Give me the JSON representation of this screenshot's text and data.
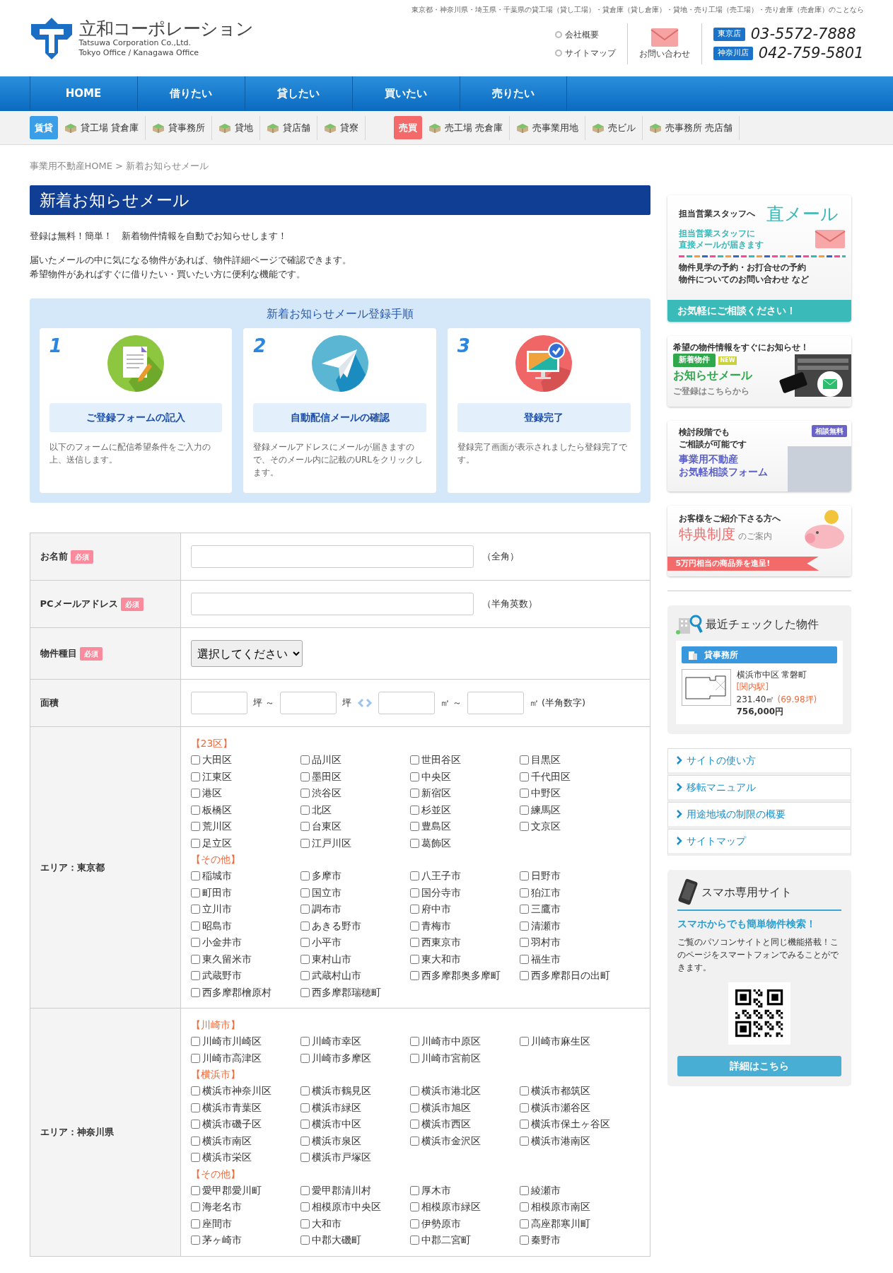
{
  "header": {
    "tagline": "東京都・神奈川県・埼玉県・千葉県の貸工場（貸し工場）・貸倉庫（貸し倉庫）・貸地・売り工場（売工場）・売り倉庫（売倉庫）のことなら",
    "company": "立和コーポレーション",
    "company_en": "Tatsuwa Corporation Co.,Ltd.",
    "offices_en": "Tokyo Office / Kanagawa Office",
    "links": [
      "会社概要",
      "サイトマップ"
    ],
    "contact": "お問い合わせ",
    "phones": [
      {
        "office": "東京店",
        "number": "03-5572-7888"
      },
      {
        "office": "神奈川店",
        "number": "042-759-5801"
      }
    ]
  },
  "main_nav": [
    "HOME",
    "借りたい",
    "貸したい",
    "買いたい",
    "売りたい"
  ],
  "sub_nav": [
    {
      "kind": "tag",
      "label": "賃貸",
      "color": "#3b9ee8"
    },
    {
      "kind": "link",
      "label": "貸工場 貸倉庫"
    },
    {
      "kind": "link",
      "label": "貸事務所"
    },
    {
      "kind": "link",
      "label": "貸地"
    },
    {
      "kind": "link",
      "label": "貸店舗"
    },
    {
      "kind": "link",
      "label": "貸寮"
    },
    {
      "kind": "tag",
      "label": "売買",
      "color": "#f26a6a"
    },
    {
      "kind": "link",
      "label": "売工場 売倉庫"
    },
    {
      "kind": "link",
      "label": "売事業用地"
    },
    {
      "kind": "link",
      "label": "売ビル"
    },
    {
      "kind": "link",
      "label": "売事務所 売店舗"
    }
  ],
  "breadcrumb": {
    "home": "事業用不動産HOME",
    "separator": ">",
    "current": "新着お知らせメール"
  },
  "page_title": "新着お知らせメール",
  "intro": [
    "登録は無料！簡単！　新着物件情報を自動でお知らせします！",
    "届いたメールの中に気になる物件があれば、物件詳細ページで確認できます。",
    "希望物件があればすぐに借りたい・買いたい方に便利な機能です。"
  ],
  "steps": {
    "title": "新着お知らせメール登録手順",
    "items": [
      {
        "number": "1",
        "heading": "ご登録フォームの記入",
        "text": "以下のフォームに配信希望条件をご入力の上、送信します。"
      },
      {
        "number": "2",
        "heading": "自動配信メールの確認",
        "text": "登録メールアドレスにメールが届きますので、そのメール内に記載のURLをクリックします。"
      },
      {
        "number": "3",
        "heading": "登録完了",
        "text": "登録完了画面が表示されましたら登録完了です。"
      }
    ]
  },
  "form": [
    {
      "kind": "text",
      "label": "お名前",
      "badge": "必須",
      "note": "（全角）"
    },
    {
      "kind": "text",
      "label": "PCメールアドレス",
      "badge": "必須",
      "note": "（半角英数）"
    },
    {
      "kind": "select",
      "label": "物件種目",
      "badge": "必須",
      "value": "選択してください"
    },
    {
      "kind": "range",
      "label": "面積",
      "units": [
        "坪 ～",
        "坪",
        "㎡ ～",
        "㎡ (半角数字)"
      ]
    },
    {
      "kind": "areas",
      "label": "エリア：東京都",
      "groups": [
        {
          "title": "【23区】",
          "options": [
            {
              "label": "大田区",
              "checked": false
            },
            {
              "label": "品川区",
              "checked": false
            },
            {
              "label": "世田谷区",
              "checked": false
            },
            {
              "label": "目黒区",
              "checked": false
            },
            {
              "label": "江東区",
              "checked": false
            },
            {
              "label": "墨田区",
              "checked": false
            },
            {
              "label": "中央区",
              "checked": false
            },
            {
              "label": "千代田区",
              "checked": false
            },
            {
              "label": "港区",
              "checked": false
            },
            {
              "label": "渋谷区",
              "checked": false
            },
            {
              "label": "新宿区",
              "checked": false
            },
            {
              "label": "中野区",
              "checked": false
            },
            {
              "label": "板橋区",
              "checked": false
            },
            {
              "label": "北区",
              "checked": false
            },
            {
              "label": "杉並区",
              "checked": false
            },
            {
              "label": "練馬区",
              "checked": false
            },
            {
              "label": "荒川区",
              "checked": false
            },
            {
              "label": "台東区",
              "checked": false
            },
            {
              "label": "豊島区",
              "checked": false
            },
            {
              "label": "文京区",
              "checked": false
            },
            {
              "label": "足立区",
              "checked": false
            },
            {
              "label": "江戸川区",
              "checked": false
            },
            {
              "label": "葛飾区",
              "checked": false
            }
          ]
        },
        {
          "title": "【その他】",
          "options": [
            {
              "label": "稲城市",
              "checked": false
            },
            {
              "label": "多摩市",
              "checked": false
            },
            {
              "label": "八王子市",
              "checked": false
            },
            {
              "label": "日野市",
              "checked": false
            },
            {
              "label": "町田市",
              "checked": false
            },
            {
              "label": "国立市",
              "checked": false
            },
            {
              "label": "国分寺市",
              "checked": false
            },
            {
              "label": "狛江市",
              "checked": false
            },
            {
              "label": "立川市",
              "checked": false
            },
            {
              "label": "調布市",
              "checked": false
            },
            {
              "label": "府中市",
              "checked": false
            },
            {
              "label": "三鷹市",
              "checked": false
            },
            {
              "label": "昭島市",
              "checked": false
            },
            {
              "label": "あきる野市",
              "checked": false
            },
            {
              "label": "青梅市",
              "checked": false
            },
            {
              "label": "清瀬市",
              "checked": false
            },
            {
              "label": "小金井市",
              "checked": false
            },
            {
              "label": "小平市",
              "checked": false
            },
            {
              "label": "西東京市",
              "checked": false
            },
            {
              "label": "羽村市",
              "checked": false
            },
            {
              "label": "東久留米市",
              "checked": false
            },
            {
              "label": "東村山市",
              "checked": false
            },
            {
              "label": "東大和市",
              "checked": false
            },
            {
              "label": "福生市",
              "checked": false
            },
            {
              "label": "武蔵野市",
              "checked": false
            },
            {
              "label": "武蔵村山市",
              "checked": false
            },
            {
              "label": "西多摩郡奥多摩町",
              "checked": false
            },
            {
              "label": "西多摩郡日の出町",
              "checked": false
            },
            {
              "label": "西多摩郡檜原村",
              "checked": false
            },
            {
              "label": "西多摩郡瑞穂町",
              "checked": false
            }
          ]
        }
      ]
    },
    {
      "kind": "areas",
      "label": "エリア：神奈川県",
      "groups": [
        {
          "title": "【川崎市】",
          "options": [
            {
              "label": "川崎市川崎区",
              "checked": false
            },
            {
              "label": "川崎市幸区",
              "checked": false
            },
            {
              "label": "川崎市中原区",
              "checked": false
            },
            {
              "label": "川崎市麻生区",
              "checked": false
            },
            {
              "label": "川崎市高津区",
              "checked": false
            },
            {
              "label": "川崎市多摩区",
              "checked": false
            },
            {
              "label": "川崎市宮前区",
              "checked": false
            }
          ]
        },
        {
          "title": "【横浜市】",
          "options": [
            {
              "label": "横浜市神奈川区",
              "checked": false
            },
            {
              "label": "横浜市鶴見区",
              "checked": false
            },
            {
              "label": "横浜市港北区",
              "checked": false
            },
            {
              "label": "横浜市都筑区",
              "checked": false
            },
            {
              "label": "横浜市青葉区",
              "checked": false
            },
            {
              "label": "横浜市緑区",
              "checked": false
            },
            {
              "label": "横浜市旭区",
              "checked": false
            },
            {
              "label": "横浜市瀬谷区",
              "checked": false
            },
            {
              "label": "横浜市磯子区",
              "checked": false
            },
            {
              "label": "横浜市中区",
              "checked": false
            },
            {
              "label": "横浜市西区",
              "checked": false
            },
            {
              "label": "横浜市保土ヶ谷区",
              "checked": false
            },
            {
              "label": "横浜市南区",
              "checked": false
            },
            {
              "label": "横浜市泉区",
              "checked": false
            },
            {
              "label": "横浜市金沢区",
              "checked": false
            },
            {
              "label": "横浜市港南区",
              "checked": false
            },
            {
              "label": "横浜市栄区",
              "checked": false
            },
            {
              "label": "横浜市戸塚区",
              "checked": false
            }
          ]
        },
        {
          "title": "【その他】",
          "options": [
            {
              "label": "愛甲郡愛川町",
              "checked": false
            },
            {
              "label": "愛甲郡清川村",
              "checked": false
            },
            {
              "label": "厚木市",
              "checked": false
            },
            {
              "label": "綾瀬市",
              "checked": false
            },
            {
              "label": "海老名市",
              "checked": false
            },
            {
              "label": "相模原市中央区",
              "checked": false
            },
            {
              "label": "相模原市緑区",
              "checked": false
            },
            {
              "label": "相模原市南区",
              "checked": false
            },
            {
              "label": "座間市",
              "checked": false
            },
            {
              "label": "大和市",
              "checked": false
            },
            {
              "label": "伊勢原市",
              "checked": false
            },
            {
              "label": "高座郡寒川町",
              "checked": false
            },
            {
              "label": "茅ヶ崎市",
              "checked": false
            },
            {
              "label": "中郡大磯町",
              "checked": false
            },
            {
              "label": "中郡二宮町",
              "checked": false
            },
            {
              "label": "秦野市",
              "checked": false
            }
          ]
        }
      ]
    }
  ],
  "sidebar": {
    "banners": [
      {
        "kind": "direct",
        "lead": "担当営業スタッフへ",
        "title": "直メール",
        "sub": [
          "担当営業スタッフに",
          "直接メールが届きます"
        ],
        "body": [
          "物件見学の予約・お打合せの予約",
          "物件についてのお問い合わせ など"
        ],
        "footer": "お気軽にご相談ください！"
      },
      {
        "kind": "newmail",
        "lead": "希望の物件情報をすぐにお知らせ！",
        "tag": "新着物件",
        "new": "NEW",
        "title": "お知らせメール",
        "sub": "ご登録はこちらから"
      },
      {
        "kind": "consult",
        "lead": [
          "検討段階でも",
          "ご相談が可能です"
        ],
        "badge": "相談無料",
        "title": [
          "事業用不動産",
          "お気軽相談フォーム"
        ]
      },
      {
        "kind": "referral",
        "lead": "お客様をご紹介下さる方へ",
        "title": "特典制度",
        "suffix": "のご案内",
        "ribbon": "5万円相当の商品券を進呈!"
      }
    ],
    "recent": {
      "title": "最近チェックした物件",
      "category": "貸事務所",
      "address": "横浜市中区 常磐町",
      "station": "[関内駅]",
      "area": "231.40㎡",
      "tsubo": "(69.98坪)",
      "price": "756,000円"
    },
    "links": [
      "サイトの使い方",
      "移転マニュアル",
      "用途地域の制限の概要",
      "サイトマップ"
    ],
    "mobile": {
      "title": "スマホ専用サイト",
      "headline": "スマホからでも簡単物件検索！",
      "text": "ご覧のパソコンサイトと同じ機能搭載！このページをスマートフォンでみることができます。",
      "button": "詳細はこちら"
    }
  }
}
